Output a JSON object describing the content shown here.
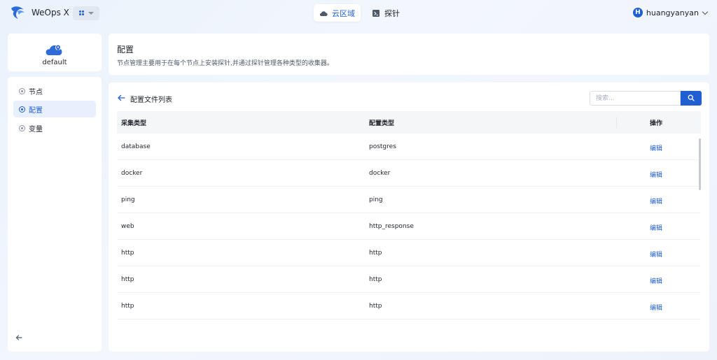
{
  "app": {
    "title": "WeOps X"
  },
  "nav": {
    "tabs": [
      {
        "label": "云区域",
        "active": true
      },
      {
        "label": "探针",
        "active": false
      }
    ]
  },
  "user": {
    "initial": "H",
    "name": "huangyanyan"
  },
  "sidebar": {
    "cloud_name": "default",
    "items": [
      {
        "label": "节点",
        "active": false
      },
      {
        "label": "配置",
        "active": true
      },
      {
        "label": "变量",
        "active": false
      }
    ]
  },
  "header": {
    "title": "配置",
    "description": "节点管理主要用于在每个节点上安装探针,并通过探针管理各种类型的收集器。"
  },
  "list": {
    "title": "配置文件列表",
    "search_placeholder": "搜索..."
  },
  "table": {
    "columns": [
      "采集类型",
      "配置类型",
      "操作"
    ],
    "rows": [
      {
        "collect_type": "database",
        "config_type": "postgres",
        "action": "编辑"
      },
      {
        "collect_type": "docker",
        "config_type": "docker",
        "action": "编辑"
      },
      {
        "collect_type": "ping",
        "config_type": "ping",
        "action": "编辑"
      },
      {
        "collect_type": "web",
        "config_type": "http_response",
        "action": "编辑"
      },
      {
        "collect_type": "http",
        "config_type": "http",
        "action": "编辑"
      },
      {
        "collect_type": "http",
        "config_type": "http",
        "action": "编辑"
      },
      {
        "collect_type": "http",
        "config_type": "http",
        "action": "编辑"
      }
    ]
  },
  "colors": {
    "accent": "#1f5fd1",
    "active_bg": "#e8f0fd"
  }
}
